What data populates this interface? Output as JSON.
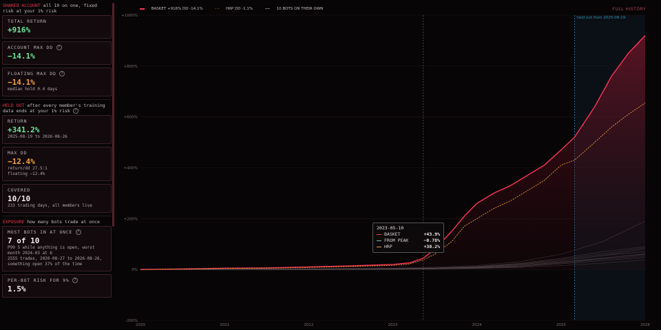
{
  "sidebar": {
    "shared_head": "SHARED ACCOUNT",
    "shared_desc": " all 10 on one, fixed risk at your 1% risk",
    "total_return": {
      "label": "TOTAL RETURN",
      "value": "+916%"
    },
    "account_max_dd": {
      "label": "ACCOUNT MAX DD",
      "value": "−14.1%"
    },
    "floating_max_dd": {
      "label": "FLOATING MAX DD",
      "value": "−14.1%",
      "sub": "median hold 0.4 days"
    },
    "held_head": "HELD OUT",
    "held_desc": " after every member's training data ends at your 1% risk",
    "return": {
      "label": "RETURN",
      "value": "+341.2%",
      "sub": "2025-08-19 to 2026-08-26"
    },
    "max_dd": {
      "label": "MAX DD",
      "value": "−12.4%",
      "sub1": "return/dd 27.5:1",
      "sub2": "floating −12.4%"
    },
    "covered": {
      "label": "COVERED",
      "value": "10/10",
      "sub": "233 trading days, all members live"
    },
    "exposure_head": "EXPOSURE",
    "exposure_desc": " how many bots trade at once",
    "most_bots": {
      "label": "MOST BOTS IN AT ONCE",
      "value": "7 of 10",
      "sub1": "P99 5 while anything is open, worst month 2024-03 at 6",
      "sub2": "2555 trades, 2020-08-27 to 2026-08-26, something open 37% of the time"
    },
    "per_bot": {
      "label": "PER-BOT RISK FOR 9%",
      "value": "1.5%"
    }
  },
  "legend": {
    "basket": "BASKET +916%  DD -14.1%",
    "hrp": "HRP DD -1.1%",
    "bots": "10 BOTS ON THEIR OWN"
  },
  "full_history": "FULL HISTORY",
  "held_out_label": "held out from 2025-08-19",
  "tooltip": {
    "date": "2023-05-10",
    "rows": [
      {
        "name": "BASKET",
        "value": "+43.9%",
        "color": "#e8374f"
      },
      {
        "name": "FROM PEAK",
        "value": "−0.78%",
        "color": "#7fb8a8"
      },
      {
        "name": "HRP",
        "value": "+38.2%",
        "color": "#f3a23a"
      }
    ]
  },
  "colors": {
    "basket": "#ff3355",
    "hrp": "#f3a23a",
    "bots": "#5a5457",
    "held_out": "#2c8fb5"
  },
  "chart_data": {
    "type": "line",
    "y_tick_labels": [
      "+1000%",
      "+800%",
      "+600%",
      "+400%",
      "+200%",
      "0%",
      "-200%"
    ],
    "y_ticks": [
      1000,
      800,
      600,
      400,
      200,
      0,
      -200
    ],
    "ylim": [
      -200,
      1000
    ],
    "x_tick_labels": [
      "2020",
      "2021",
      "2022",
      "2023",
      "2024",
      "2025",
      "2026"
    ],
    "x_ticks": [
      2020,
      2021,
      2022,
      2023,
      2024,
      2025,
      2026
    ],
    "xlim": [
      2020,
      2026
    ],
    "held_out_start": 2025.16,
    "hover_x": 2023.36,
    "series": [
      {
        "name": "BASKET",
        "x": [
          2020,
          2020.5,
          2021,
          2021.5,
          2022,
          2022.5,
          2023,
          2023.2,
          2023.36,
          2023.5,
          2023.7,
          2023.85,
          2024,
          2024.2,
          2024.4,
          2024.6,
          2024.8,
          2025,
          2025.16,
          2025.4,
          2025.6,
          2025.8,
          2026
        ],
        "y": [
          0,
          2,
          5,
          6,
          10,
          14,
          20,
          26,
          44,
          80,
          150,
          210,
          260,
          300,
          330,
          370,
          410,
          470,
          520,
          640,
          760,
          850,
          920
        ]
      },
      {
        "name": "HRP",
        "x": [
          2020,
          2020.5,
          2021,
          2021.5,
          2022,
          2022.5,
          2023,
          2023.2,
          2023.36,
          2023.5,
          2023.7,
          2023.85,
          2024,
          2024.2,
          2024.4,
          2024.6,
          2024.8,
          2025,
          2025.16,
          2025.4,
          2025.6,
          2025.8,
          2026
        ],
        "y": [
          0,
          2,
          4,
          5,
          8,
          12,
          16,
          22,
          38,
          60,
          110,
          170,
          200,
          240,
          270,
          310,
          350,
          410,
          430,
          500,
          560,
          610,
          655
        ]
      },
      {
        "name": "10 BOTS ON THEIR OWN",
        "x": [
          2020,
          2021,
          2022,
          2023,
          2023.5,
          2024,
          2024.5,
          2025,
          2025.5,
          2026
        ],
        "lines": [
          [
            0,
            1,
            2,
            3,
            5,
            10,
            20,
            35,
            55,
            70
          ],
          [
            0,
            -1,
            0,
            2,
            4,
            8,
            15,
            30,
            45,
            60
          ],
          [
            0,
            0,
            1,
            1,
            3,
            6,
            12,
            25,
            40,
            55
          ],
          [
            0,
            1,
            3,
            5,
            9,
            16,
            30,
            60,
            110,
            190
          ],
          [
            0,
            0,
            -1,
            0,
            2,
            5,
            10,
            22,
            35,
            48
          ],
          [
            0,
            1,
            2,
            4,
            6,
            12,
            24,
            44,
            70,
            90
          ],
          [
            0,
            0,
            0,
            1,
            2,
            4,
            8,
            15,
            25,
            38
          ],
          [
            0,
            1,
            1,
            2,
            4,
            9,
            18,
            34,
            56,
            80
          ],
          [
            0,
            0,
            1,
            2,
            3,
            7,
            14,
            28,
            44,
            62
          ],
          [
            0,
            1,
            2,
            3,
            6,
            11,
            22,
            40,
            62,
            85
          ]
        ]
      }
    ]
  }
}
